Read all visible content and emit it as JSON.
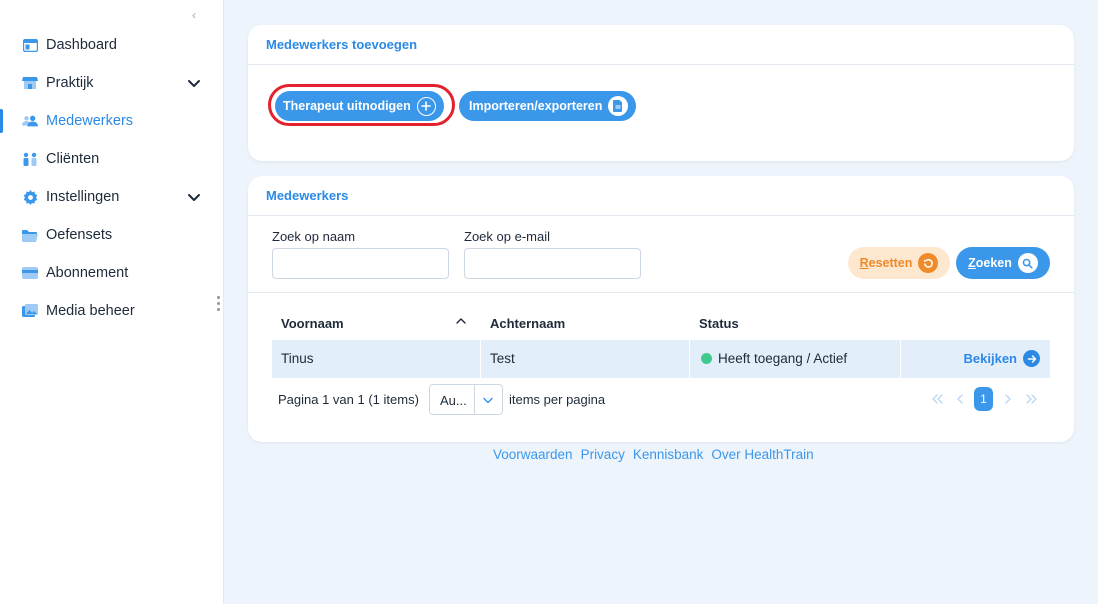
{
  "sidebar": {
    "collapse_icon": "chevron-left-icon",
    "items": [
      {
        "label": "Dashboard",
        "icon": "dashboard-icon",
        "active": false,
        "has_submenu": false
      },
      {
        "label": "Praktijk",
        "icon": "store-icon",
        "active": false,
        "has_submenu": true
      },
      {
        "label": "Medewerkers",
        "icon": "users-icon",
        "active": true,
        "has_submenu": false
      },
      {
        "label": "Cliënten",
        "icon": "clients-icon",
        "active": false,
        "has_submenu": false
      },
      {
        "label": "Instellingen",
        "icon": "gear-icon",
        "active": false,
        "has_submenu": true
      },
      {
        "label": "Oefensets",
        "icon": "folder-icon",
        "active": false,
        "has_submenu": false
      },
      {
        "label": "Abonnement",
        "icon": "credit-card-icon",
        "active": false,
        "has_submenu": false
      },
      {
        "label": "Media beheer",
        "icon": "media-icon",
        "active": false,
        "has_submenu": false
      }
    ]
  },
  "add_card": {
    "title": "Medewerkers toevoegen",
    "invite_button": "Therapeut uitnodigen",
    "import_button": "Importeren/exporteren"
  },
  "staff_card": {
    "title": "Medewerkers",
    "filters": {
      "name_label": "Zoek op naam",
      "name_value": "",
      "email_label": "Zoek op e-mail",
      "email_value": ""
    },
    "reset_button": {
      "first": "R",
      "rest": "esetten"
    },
    "search_button": {
      "first": "Z",
      "rest": "oeken"
    },
    "table": {
      "columns": [
        "Voornaam",
        "Achternaam",
        "Status"
      ],
      "rows": [
        {
          "first_name": "Tinus",
          "last_name": "Test",
          "status": "Heeft toegang / Actief",
          "action": "Bekijken"
        }
      ]
    },
    "pager": {
      "summary": "Pagina 1 van 1 (1 items)",
      "page_size": "Au...",
      "page_size_label": "items per pagina",
      "current_page": "1"
    }
  },
  "footer": {
    "links": [
      "Voorwaarden",
      "Privacy",
      "Kennisbank",
      "Over HealthTrain"
    ]
  },
  "colors": {
    "accent": "#3b97ea",
    "highlight_ring": "#e2232f",
    "reset": "#ef8b2a",
    "status_active": "#3fc98c"
  }
}
